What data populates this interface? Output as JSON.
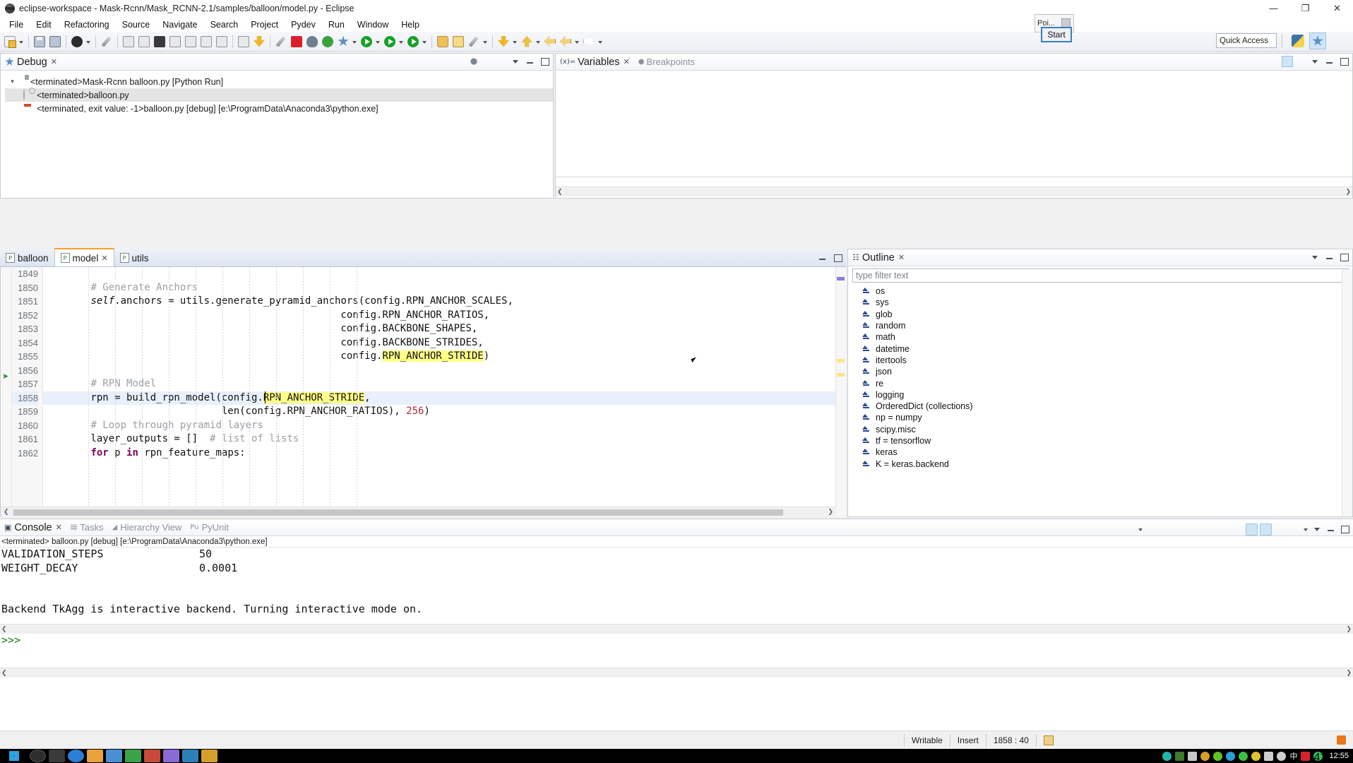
{
  "window": {
    "title": "eclipse-workspace - Mask-Rcnn/Mask_RCNN-2.1/samples/balloon/model.py - Eclipse",
    "minimize": "—",
    "maximize": "❐",
    "close": "✕"
  },
  "menu": [
    "File",
    "Edit",
    "Refactoring",
    "Source",
    "Navigate",
    "Search",
    "Project",
    "Pydev",
    "Run",
    "Window",
    "Help"
  ],
  "toolbar": {
    "quick_access": "Quick Access"
  },
  "popup": {
    "title": "Poi...",
    "start_label": "Start"
  },
  "debug_view": {
    "tab_label": "Debug",
    "tree": [
      {
        "level": 1,
        "twisty": "▾",
        "icon": "python-launch-icon",
        "label": "<terminated>Mask-Rcnn balloon.py [Python Run]",
        "selected": false
      },
      {
        "level": 2,
        "twisty": "",
        "icon": "thread-icon",
        "label": "<terminated>balloon.py",
        "selected": true
      },
      {
        "level": 3,
        "twisty": "",
        "icon": "process-icon",
        "label": "<terminated, exit value: -1>balloon.py [debug] [e:\\ProgramData\\Anaconda3\\python.exe]",
        "selected": false
      }
    ]
  },
  "variables_view": {
    "tabs": [
      {
        "label": "Variables",
        "active": true
      },
      {
        "label": "Breakpoints",
        "active": false
      }
    ]
  },
  "editor": {
    "tabs": [
      {
        "label": "balloon",
        "active": false,
        "closable": false
      },
      {
        "label": "model",
        "active": true,
        "closable": true
      },
      {
        "label": "utils",
        "active": false,
        "closable": false
      }
    ],
    "first_line_number": 1849,
    "current_line": 1858,
    "lines": [
      {
        "n": 1849,
        "html": ""
      },
      {
        "n": 1850,
        "html": "        <span class=\"cm\"># Generate Anchors</span>"
      },
      {
        "n": 1851,
        "html": "        <span class=\"it\">self</span>.anchors = utils.generate_pyramid_anchors(config.RPN_ANCHOR_SCALES,"
      },
      {
        "n": 1852,
        "html": "                                                  config.RPN_ANCHOR_RATIOS,"
      },
      {
        "n": 1853,
        "html": "                                                  config.BACKBONE_SHAPES,"
      },
      {
        "n": 1854,
        "html": "                                                  config.BACKBONE_STRIDES,"
      },
      {
        "n": 1855,
        "html": "                                                  config.<span class=\"hl\">RPN_ANCHOR_STRIDE</span>)"
      },
      {
        "n": 1856,
        "html": ""
      },
      {
        "n": 1857,
        "html": "        <span class=\"cm\"># RPN Model</span>"
      },
      {
        "n": 1858,
        "html": "        rpn = build_rpn_model(config.<span class=\"hl\">RPN_ANCHOR_STRIDE</span>,"
      },
      {
        "n": 1859,
        "html": "                              len(config.RPN_ANCHOR_RATIOS), <span class=\"num\">256</span>)"
      },
      {
        "n": 1860,
        "html": "        <span class=\"cm\"># Loop through pyramid layers</span>"
      },
      {
        "n": 1861,
        "html": "        layer_outputs = []  <span class=\"cm\"># list of lists</span>"
      },
      {
        "n": 1862,
        "html": "        <span class=\"kw\">for</span> p <span class=\"kw\">in</span> rpn_feature_maps:"
      }
    ]
  },
  "outline": {
    "tab_label": "Outline",
    "filter_placeholder": "type filter text",
    "items": [
      "os",
      "sys",
      "glob",
      "random",
      "math",
      "datetime",
      "itertools",
      "json",
      "re",
      "logging",
      "OrderedDict (collections)",
      "np = numpy",
      "scipy.misc",
      "tf = tensorflow",
      "keras",
      "K = keras.backend"
    ]
  },
  "console": {
    "tabs": [
      {
        "label": "Console",
        "active": true
      },
      {
        "label": "Tasks",
        "active": false
      },
      {
        "label": "Hierarchy View",
        "active": false
      },
      {
        "label": "PyUnit",
        "active": false
      }
    ],
    "subtitle": "<terminated> balloon.py [debug] [e:\\ProgramData\\Anaconda3\\python.exe]",
    "output": [
      "VALIDATION_STEPS               50",
      "WEIGHT_DECAY                   0.0001",
      "",
      "Backend TkAgg is interactive backend. Turning interactive mode on."
    ],
    "prompt": ">>>"
  },
  "statusbar": {
    "writable": "Writable",
    "insert": "Insert",
    "position": "1858 : 40"
  },
  "taskbar": {
    "clock": "12:55",
    "ime": "中",
    "badge": "41"
  },
  "colors": {
    "accent": "#3a7ebf",
    "highlight": "#ffff88",
    "comment": "#9aa0a6",
    "number": "#b02a37",
    "keyword": "#7f0055",
    "current_line": "#e8f0fb",
    "tab_active_top": "#ff9c2a"
  }
}
